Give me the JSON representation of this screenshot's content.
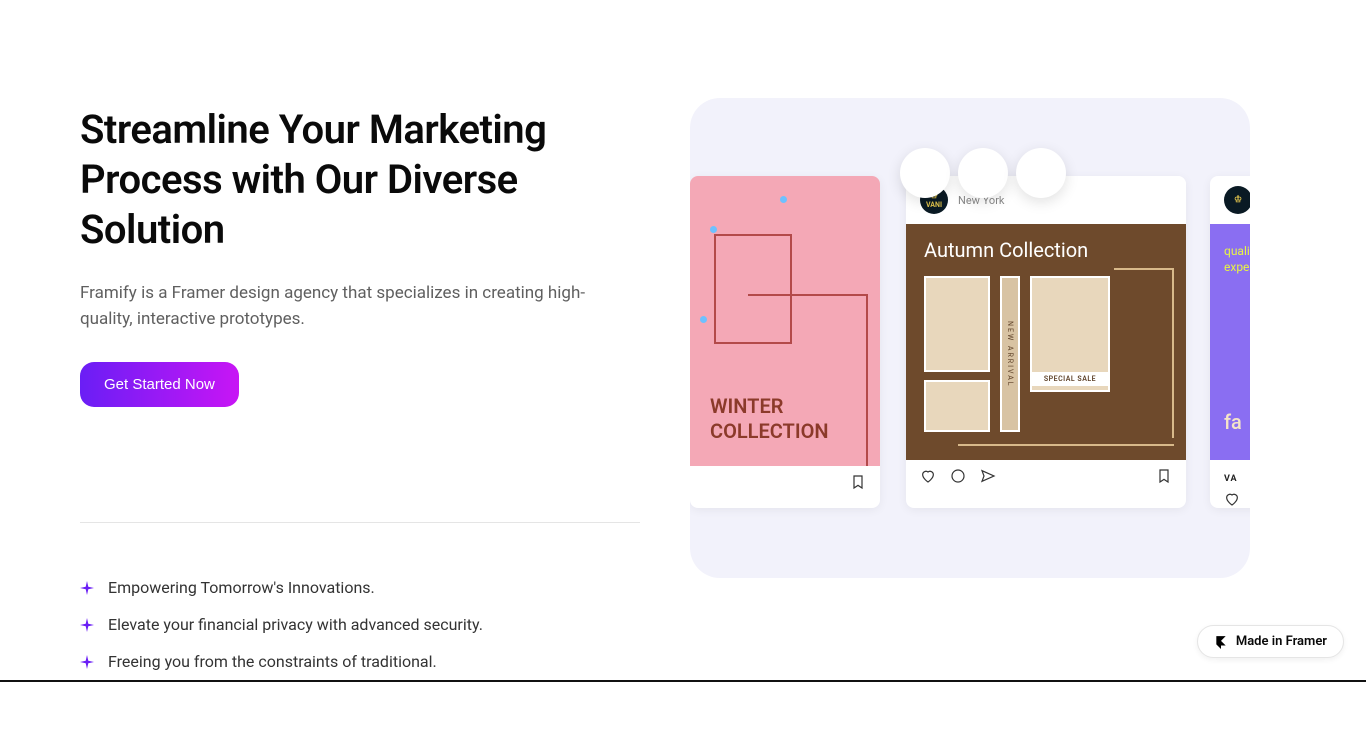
{
  "hero": {
    "headline": "Streamline Your Marketing Process with Our Diverse Solution",
    "subhead": "Framify is a Framer design agency that specializes in creating high-quality, interactive prototypes.",
    "cta_label": "Get Started Now"
  },
  "features": [
    "Empowering Tomorrow's Innovations.",
    "Elevate your financial privacy with advanced security.",
    "Freeing you from the constraints of traditional."
  ],
  "showcase": {
    "card_left": {
      "caption": "WINTER COLLECTION"
    },
    "card_mid": {
      "badge": "VANI",
      "location": "New York",
      "title": "Autumn Collection",
      "strip_label": "NEW ARRIVAL",
      "sale_label": "SPECIAL SALE"
    },
    "card_right": {
      "overlay_line1": "quali",
      "overlay_line2": "exper",
      "bottom_word": "fa",
      "brand": "VA"
    }
  },
  "footer": {
    "framer_badge": "Made in Framer"
  }
}
